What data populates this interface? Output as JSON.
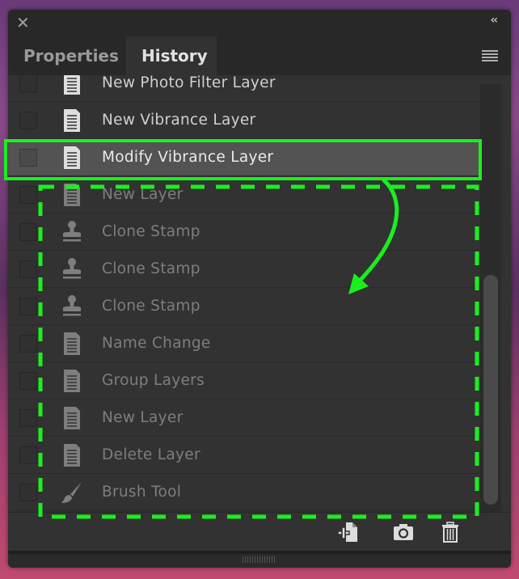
{
  "panel": {
    "close_icon": "close-icon",
    "collapse_icon": "double-chevron-left-icon",
    "tabs": [
      {
        "label": "Properties",
        "active": false
      },
      {
        "label": "History",
        "active": true
      }
    ],
    "menu_icon": "hamburger-menu-icon"
  },
  "history": {
    "items": [
      {
        "label": "New Photo Filter Layer",
        "icon": "document-icon",
        "state": "normal"
      },
      {
        "label": "New Vibrance Layer",
        "icon": "document-icon",
        "state": "normal"
      },
      {
        "label": "Modify Vibrance Layer",
        "icon": "document-icon",
        "state": "selected"
      },
      {
        "label": "New Layer",
        "icon": "document-icon",
        "state": "dimmed"
      },
      {
        "label": "Clone Stamp",
        "icon": "clone-stamp-icon",
        "state": "dimmed"
      },
      {
        "label": "Clone Stamp",
        "icon": "clone-stamp-icon",
        "state": "dimmed"
      },
      {
        "label": "Clone Stamp",
        "icon": "clone-stamp-icon",
        "state": "dimmed"
      },
      {
        "label": "Name Change",
        "icon": "document-icon",
        "state": "dimmed"
      },
      {
        "label": "Group Layers",
        "icon": "document-icon",
        "state": "dimmed"
      },
      {
        "label": "New Layer",
        "icon": "document-icon",
        "state": "dimmed"
      },
      {
        "label": "Delete Layer",
        "icon": "document-icon",
        "state": "dimmed"
      },
      {
        "label": "Brush Tool",
        "icon": "brush-icon",
        "state": "dimmed"
      }
    ]
  },
  "footer": {
    "buttons": [
      "new-document-from-state-icon",
      "camera-snapshot-icon",
      "trash-icon"
    ]
  },
  "annotation": {
    "color": "#19f01e"
  }
}
